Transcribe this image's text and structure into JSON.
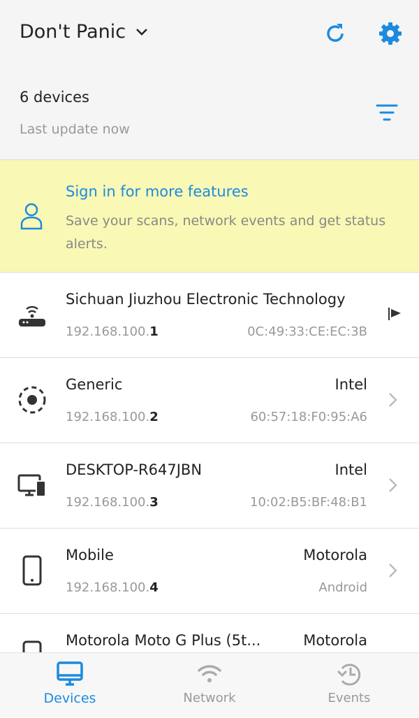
{
  "header": {
    "title": "Don't Panic",
    "device_count": "6 devices",
    "last_update": "Last update now"
  },
  "banner": {
    "title": "Sign in for more features",
    "text": "Save your scans, network events and get status alerts."
  },
  "devices": [
    {
      "name": "Sichuan Jiuzhou Electronic Technology",
      "vendor": "",
      "ip_prefix": "192.168.100.",
      "ip_suffix": "1",
      "detail": "0C:49:33:CE:EC:3B",
      "icon": "router-icon"
    },
    {
      "name": "Generic",
      "vendor": "Intel",
      "ip_prefix": "192.168.100.",
      "ip_suffix": "2",
      "detail": "60:57:18:F0:95:A6",
      "icon": "generic-device-icon"
    },
    {
      "name": "DESKTOP-R647JBN",
      "vendor": "Intel",
      "ip_prefix": "192.168.100.",
      "ip_suffix": "3",
      "detail": "10:02:B5:BF:48:B1",
      "icon": "desktop-icon"
    },
    {
      "name": "Mobile",
      "vendor": "Motorola",
      "ip_prefix": "192.168.100.",
      "ip_suffix": "4",
      "detail": "Android",
      "icon": "mobile-icon"
    },
    {
      "name": "Motorola Moto G Plus (5t...",
      "vendor": "Motorola",
      "ip_prefix": "",
      "ip_suffix": "",
      "detail": "",
      "icon": "mobile-icon"
    }
  ],
  "nav": {
    "devices": "Devices",
    "network": "Network",
    "events": "Events",
    "active": "Devices"
  },
  "colors": {
    "accent": "#1b8be0",
    "banner": "#f9f8b5"
  }
}
